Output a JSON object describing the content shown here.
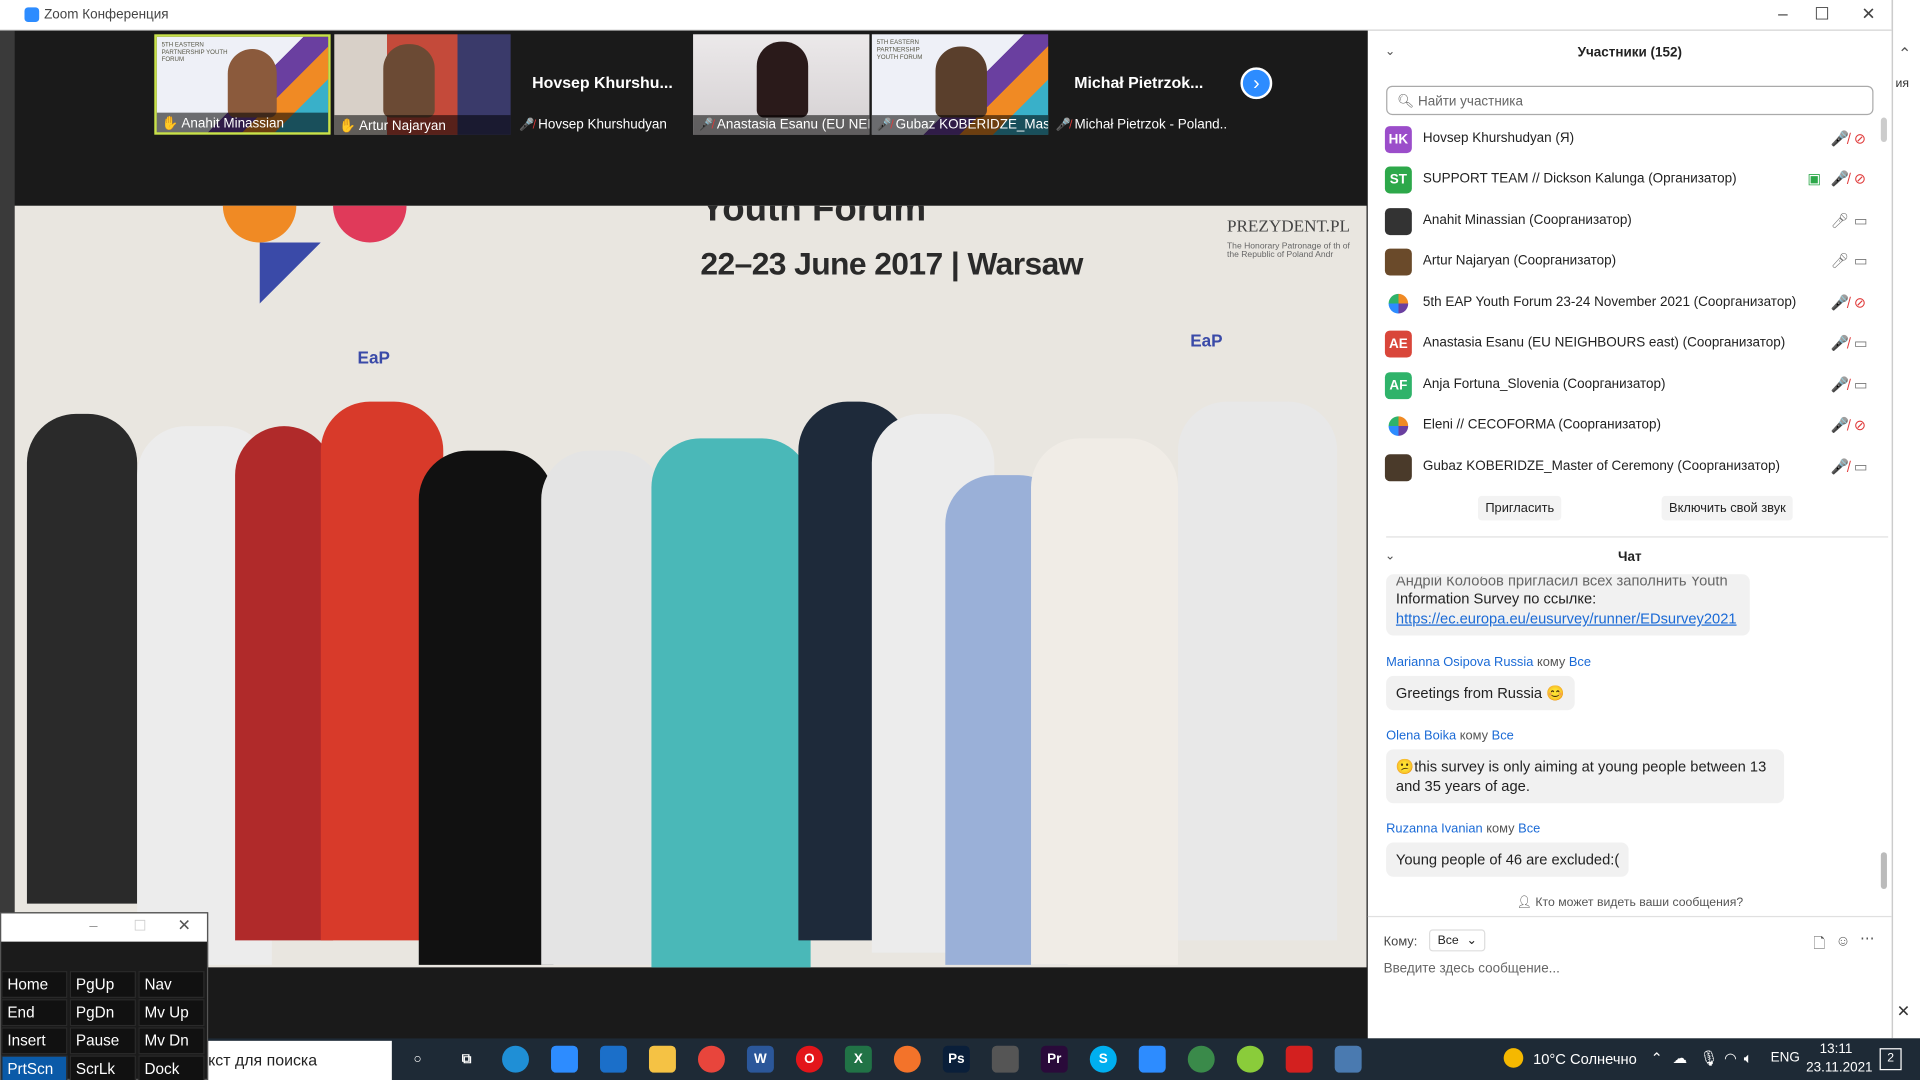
{
  "window": {
    "title": "Zoom Конференция"
  },
  "thumbnails": [
    {
      "name": "Anahit Minassian",
      "muted": false,
      "banner": "5TH EASTERN PARTNERSHIP YOUTH FORUM"
    },
    {
      "name": "Artur Najaryan",
      "muted": false
    },
    {
      "name": "Hovsep Khurshudyan",
      "big": "Hovsep  Khurshu...",
      "muted": true
    },
    {
      "name": "Anastasia Esanu (EU NEI...",
      "muted": true
    },
    {
      "name": "Gubaz KOBERIDZE_Mast...",
      "muted": true,
      "banner": "5TH EASTERN PARTNERSHIP YOUTH FORUM"
    },
    {
      "name": "Michał Pietrzok - Poland...",
      "big": "Michał  Pietrzok...",
      "muted": true
    }
  ],
  "video": {
    "banner_text": "22–23 June 2017 | Warsaw",
    "top_text": "Youth Forum",
    "brand": "PREZYDENT.PL",
    "brand_sub": "The Honorary Patronage of th of the Republic of Poland Andr",
    "eap": "EaP"
  },
  "participants": {
    "header": "Участники (152)",
    "search_placeholder": "Найти участника",
    "list": [
      {
        "initials": "HK",
        "name": "Hovsep Khurshudyan (Я)",
        "color": "#9b4dca",
        "mic": "off",
        "cam": "off"
      },
      {
        "initials": "ST",
        "name": "SUPPORT TEAM // Dickson Kalunga (Организатор)",
        "color": "#2da84a",
        "mic": "off",
        "cam": "off",
        "share": true
      },
      {
        "initials": "",
        "name": "Anahit Minassian (Соорганизатор)",
        "color": "#333",
        "mic": "on",
        "cam": "on"
      },
      {
        "initials": "",
        "name": "Artur Najaryan (Соорганизатор)",
        "color": "#6a4a2a",
        "mic": "on",
        "cam": "on"
      },
      {
        "initials": "",
        "name": "5th EAP  Youth Forum 23-24 November 2021 (Соорганизатор)",
        "color": "#ffffff",
        "mic": "off",
        "cam": "off"
      },
      {
        "initials": "AE",
        "name": "Anastasia Esanu (EU NEIGHBOURS east) (Соорганизатор)",
        "color": "#d9463a",
        "mic": "off",
        "cam": "on"
      },
      {
        "initials": "AF",
        "name": "Anja Fortuna_Slovenia (Соорганизатор)",
        "color": "#2fb36a",
        "mic": "off",
        "cam": "on"
      },
      {
        "initials": "",
        "name": "Eleni // CECOFORMA (Соорганизатор)",
        "color": "#ffffff",
        "mic": "off",
        "cam": "off"
      },
      {
        "initials": "",
        "name": "Gubaz KOBERIDZE_Master of Ceremony (Соорганизатор)",
        "color": "#4a3a2a",
        "mic": "off",
        "cam": "on"
      }
    ],
    "invite_label": "Пригласить",
    "unmute_label": "Включить свой звук"
  },
  "chat": {
    "header": "Чат",
    "messages": [
      {
        "sender": "",
        "to": "",
        "text_top": "Андрій Колобов пригласил всех заполнить Youth",
        "text": "Information Survey по ссылке:",
        "link": "https://ec.europa.eu/eusurvey/runner/EDsurvey2021"
      },
      {
        "sender": "Marianna Osipova Russia",
        "to": "кому",
        "to_target": "Все",
        "text": "Greetings from Russia 😊"
      },
      {
        "sender": "Olena Boika",
        "to": "кому",
        "to_target": "Все",
        "text": "😕this survey is only aiming at young people between 13 and 35 years of age."
      },
      {
        "sender": "Ruzanna Ivanian",
        "to": "кому",
        "to_target": "Все",
        "text": "Young people of 46 are excluded:("
      }
    ],
    "who_can_see": "Кто может видеть ваши сообщения?",
    "to_label": "Кому:",
    "to_value": "Все",
    "input_placeholder": "Введите здесь сообщение..."
  },
  "keypad": {
    "keys": [
      [
        "Home",
        "PgUp",
        "Nav"
      ],
      [
        "End",
        "PgDn",
        "Mv Up"
      ],
      [
        "Insert",
        "Pause",
        "Mv Dn"
      ],
      [
        "PrtScn",
        "ScrLk",
        "Dock"
      ]
    ]
  },
  "taskbar": {
    "search_text": "кст для поиска",
    "weather": "10°C  Солнечно",
    "lang": "ENG",
    "time": "13:11",
    "date": "23.11.2021",
    "notif_count": "2"
  },
  "right_strip_text": "ия"
}
